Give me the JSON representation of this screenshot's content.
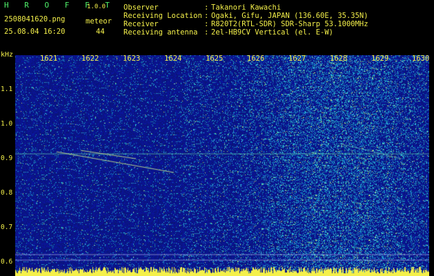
{
  "app": {
    "name": "H R O F F T",
    "version": "1.0.0",
    "filename": "2508041620.png",
    "datetime": "25.08.04 16:20",
    "meteor_label": "meteor",
    "meteor_count": "44"
  },
  "meta": {
    "observer_label": "Observer",
    "observer_value": "Takanori Kawachi",
    "location_label": "Receiving Location",
    "location_value": "Ogaki, Gifu, JAPAN (136.60E, 35.35N)",
    "receiver_label": "Receiver",
    "receiver_value": "R820T2(RTL-SDR) SDR-Sharp 53.1000MHz",
    "antenna_label": "Receiving antenna",
    "antenna_value": "2el-HB9CV Vertical (el. E-W)"
  },
  "axes": {
    "y_unit": "kHz",
    "y_ticks": [
      "1.1",
      "1.0",
      "0.9",
      "0.8",
      "0.7",
      "0.6"
    ],
    "x_ticks": [
      "1621",
      "1622",
      "1623",
      "1624",
      "1625",
      "1626",
      "1627",
      "1628",
      "1629",
      "1630"
    ]
  },
  "colors": {
    "text": "#f4f04a",
    "brand": "#4ff06a",
    "background": "#000000",
    "noise_base": "#1a2fa0",
    "noise_hot": "#3fd0e0",
    "baseline": "#f4f04a"
  }
}
